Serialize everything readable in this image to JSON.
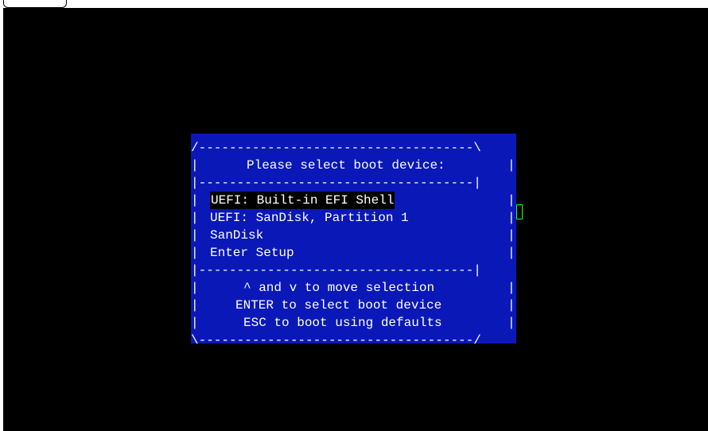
{
  "menu": {
    "border_top": "/------------------------------------\\",
    "border_bottom": "\\------------------------------------/",
    "separator": "|------------------------------------|",
    "side": "|",
    "title": "Please select boot device:",
    "items": [
      {
        "label": "UEFI: Built-in EFI Shell",
        "selected": true
      },
      {
        "label": "UEFI: SanDisk, Partition 1",
        "selected": false
      },
      {
        "label": "SanDisk",
        "selected": false
      },
      {
        "label": "Enter Setup",
        "selected": false
      }
    ],
    "help": [
      "^ and v to move selection",
      "ENTER to select boot device",
      "ESC to boot using defaults"
    ]
  },
  "colors": {
    "screen_bg": "#000000",
    "menu_bg": "#0a18b8",
    "text": "#ffffff",
    "selection_bg": "#000000",
    "cursor": "#19ff19"
  }
}
